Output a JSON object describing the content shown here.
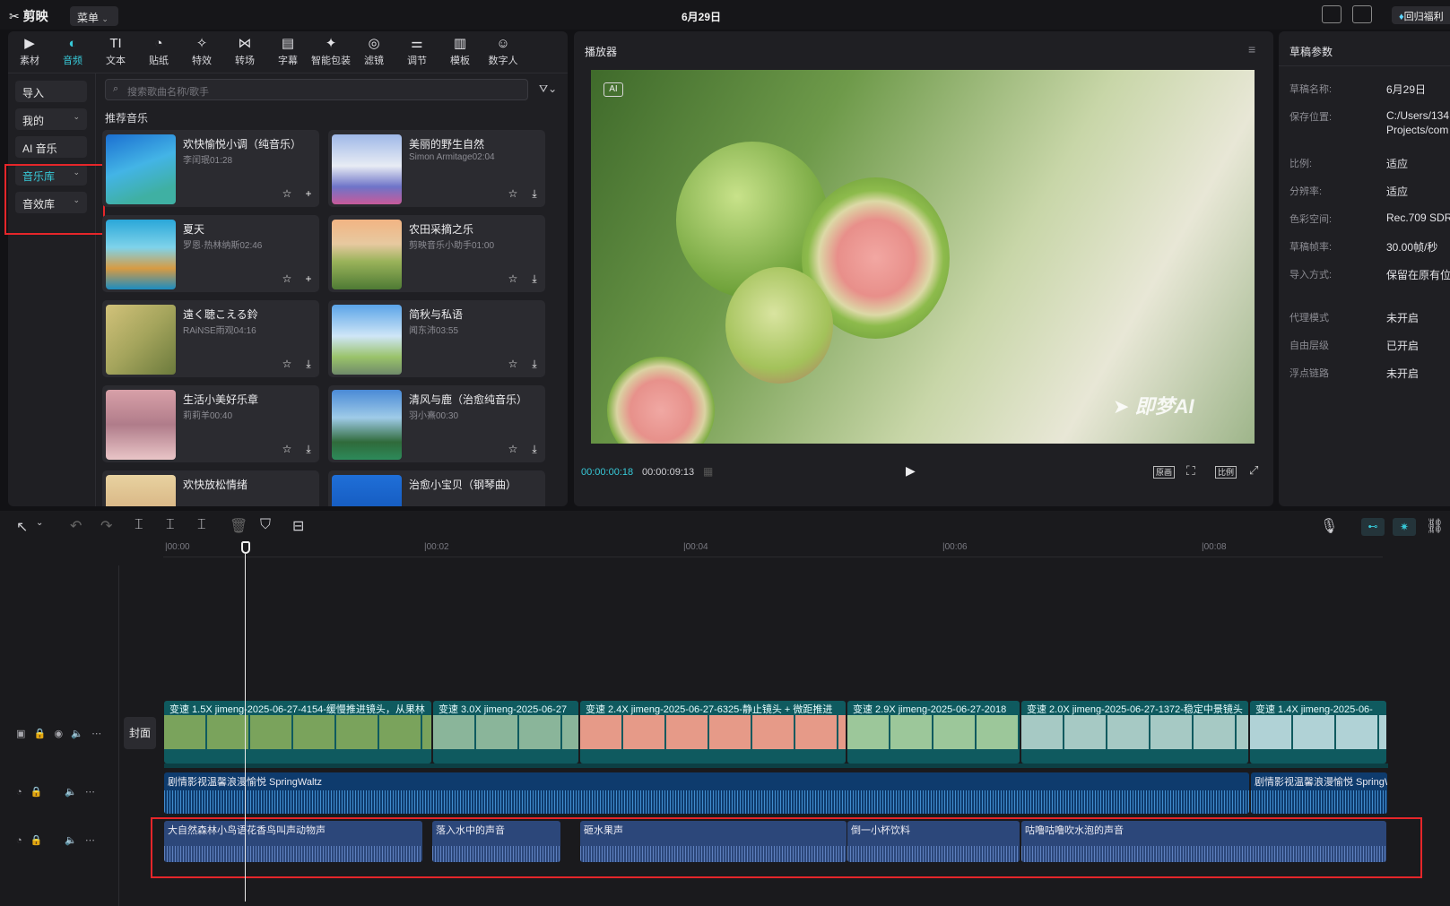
{
  "app": {
    "logo": "剪映",
    "menu": "菜单",
    "title": "6月29日",
    "promo": "回归福利"
  },
  "toolbar": [
    {
      "label": "素材",
      "icon": "play-square-icon"
    },
    {
      "label": "音频",
      "icon": "audio-icon"
    },
    {
      "label": "文本",
      "icon": "text-icon"
    },
    {
      "label": "贴纸",
      "icon": "sticker-icon"
    },
    {
      "label": "特效",
      "icon": "effects-icon"
    },
    {
      "label": "转场",
      "icon": "transition-icon"
    },
    {
      "label": "字幕",
      "icon": "subtitle-icon"
    },
    {
      "label": "智能包装",
      "icon": "smart-pack-icon"
    },
    {
      "label": "滤镜",
      "icon": "filter-icon"
    },
    {
      "label": "调节",
      "icon": "adjust-icon"
    },
    {
      "label": "模板",
      "icon": "template-icon"
    },
    {
      "label": "数字人",
      "icon": "digital-human-icon"
    }
  ],
  "sidebar": [
    "导入",
    "我的",
    "AI 音乐",
    "音乐库",
    "音效库"
  ],
  "search": {
    "placeholder": "搜索歌曲名称/歌手"
  },
  "section_title": "推荐音乐",
  "songs": [
    {
      "title": "欢快愉悦小调（纯音乐）",
      "artist": "李闰珉01:28"
    },
    {
      "title": "美丽的野生自然",
      "artist": "Simon Armitage02:04"
    },
    {
      "title": "夏天",
      "artist": "罗恩·热林纳斯02:46"
    },
    {
      "title": "农田采摘之乐",
      "artist": "剪映音乐小助手01:00"
    },
    {
      "title": "遠く聴こえる鈴",
      "artist": "RAiNSE雨观04:16"
    },
    {
      "title": "简秋与私语",
      "artist": "闻东沛03:55"
    },
    {
      "title": "生活小美好乐章",
      "artist": "莉莉羊00:40"
    },
    {
      "title": "清风与鹿（治愈纯音乐）",
      "artist": "羽小熹00:30"
    },
    {
      "title": "欢快放松情绪",
      "artist": ""
    },
    {
      "title": "治愈小宝贝（钢琴曲）",
      "artist": ""
    }
  ],
  "player": {
    "title": "播放器",
    "ai_badge": "AI",
    "watermark": "即梦AI",
    "current_time": "00:00:00:18",
    "total_time": "00:00:09:13",
    "btn_original": "原画",
    "btn_ratio": "比例"
  },
  "props": {
    "title": "草稿参数",
    "rows": [
      {
        "label": "草稿名称:",
        "value": "6月29日"
      },
      {
        "label": "保存位置:",
        "value": "C:/Users/134",
        "value2": "Projects/com"
      },
      {
        "label": "比例:",
        "value": "适应"
      },
      {
        "label": "分辨率:",
        "value": "适应"
      },
      {
        "label": "色彩空间:",
        "value": "Rec.709 SDR"
      },
      {
        "label": "草稿帧率:",
        "value": "30.00帧/秒"
      },
      {
        "label": "导入方式:",
        "value": "保留在原有位"
      },
      {
        "label": "代理模式",
        "value": "未开启"
      },
      {
        "label": "自由层级",
        "value": "已开启"
      },
      {
        "label": "浮点链路",
        "value": "未开启"
      }
    ]
  },
  "ruler": [
    "00:00",
    "00:02",
    "00:04",
    "00:06",
    "00:08"
  ],
  "cover": "封面",
  "video_clips": [
    {
      "label": "变速 1.5X   jimeng-2025-06-27-4154-缓慢推进镜头，从果林",
      "color": "#7aa35c"
    },
    {
      "label": "变速 3.0X   jimeng-2025-06-27",
      "color": "#8ab59a"
    },
    {
      "label": "变速 2.4X   jimeng-2025-06-27-6325-静止镜头 + 微距推进",
      "color": "#e69a88"
    },
    {
      "label": "变速 2.9X   jimeng-2025-06-27-2018",
      "color": "#9cc79a"
    },
    {
      "label": "变速 2.0X   jimeng-2025-06-27-1372-稳定中景镜头",
      "color": "#a6c9c4"
    },
    {
      "label": "变速 1.4X   jimeng-2025-06-",
      "color": "#b0d2d6"
    }
  ],
  "music_track": [
    "剧情影视温馨浪漫愉悦  SpringWaltz",
    "剧情影视温馨浪漫愉悦  SpringWa"
  ],
  "sfx_clips": [
    "大自然森林小鸟语花香鸟叫声动物声",
    "落入水中的声音",
    "砸水果声",
    "倒一小杯饮料",
    "咕噜咕噜吹水泡的声音"
  ]
}
